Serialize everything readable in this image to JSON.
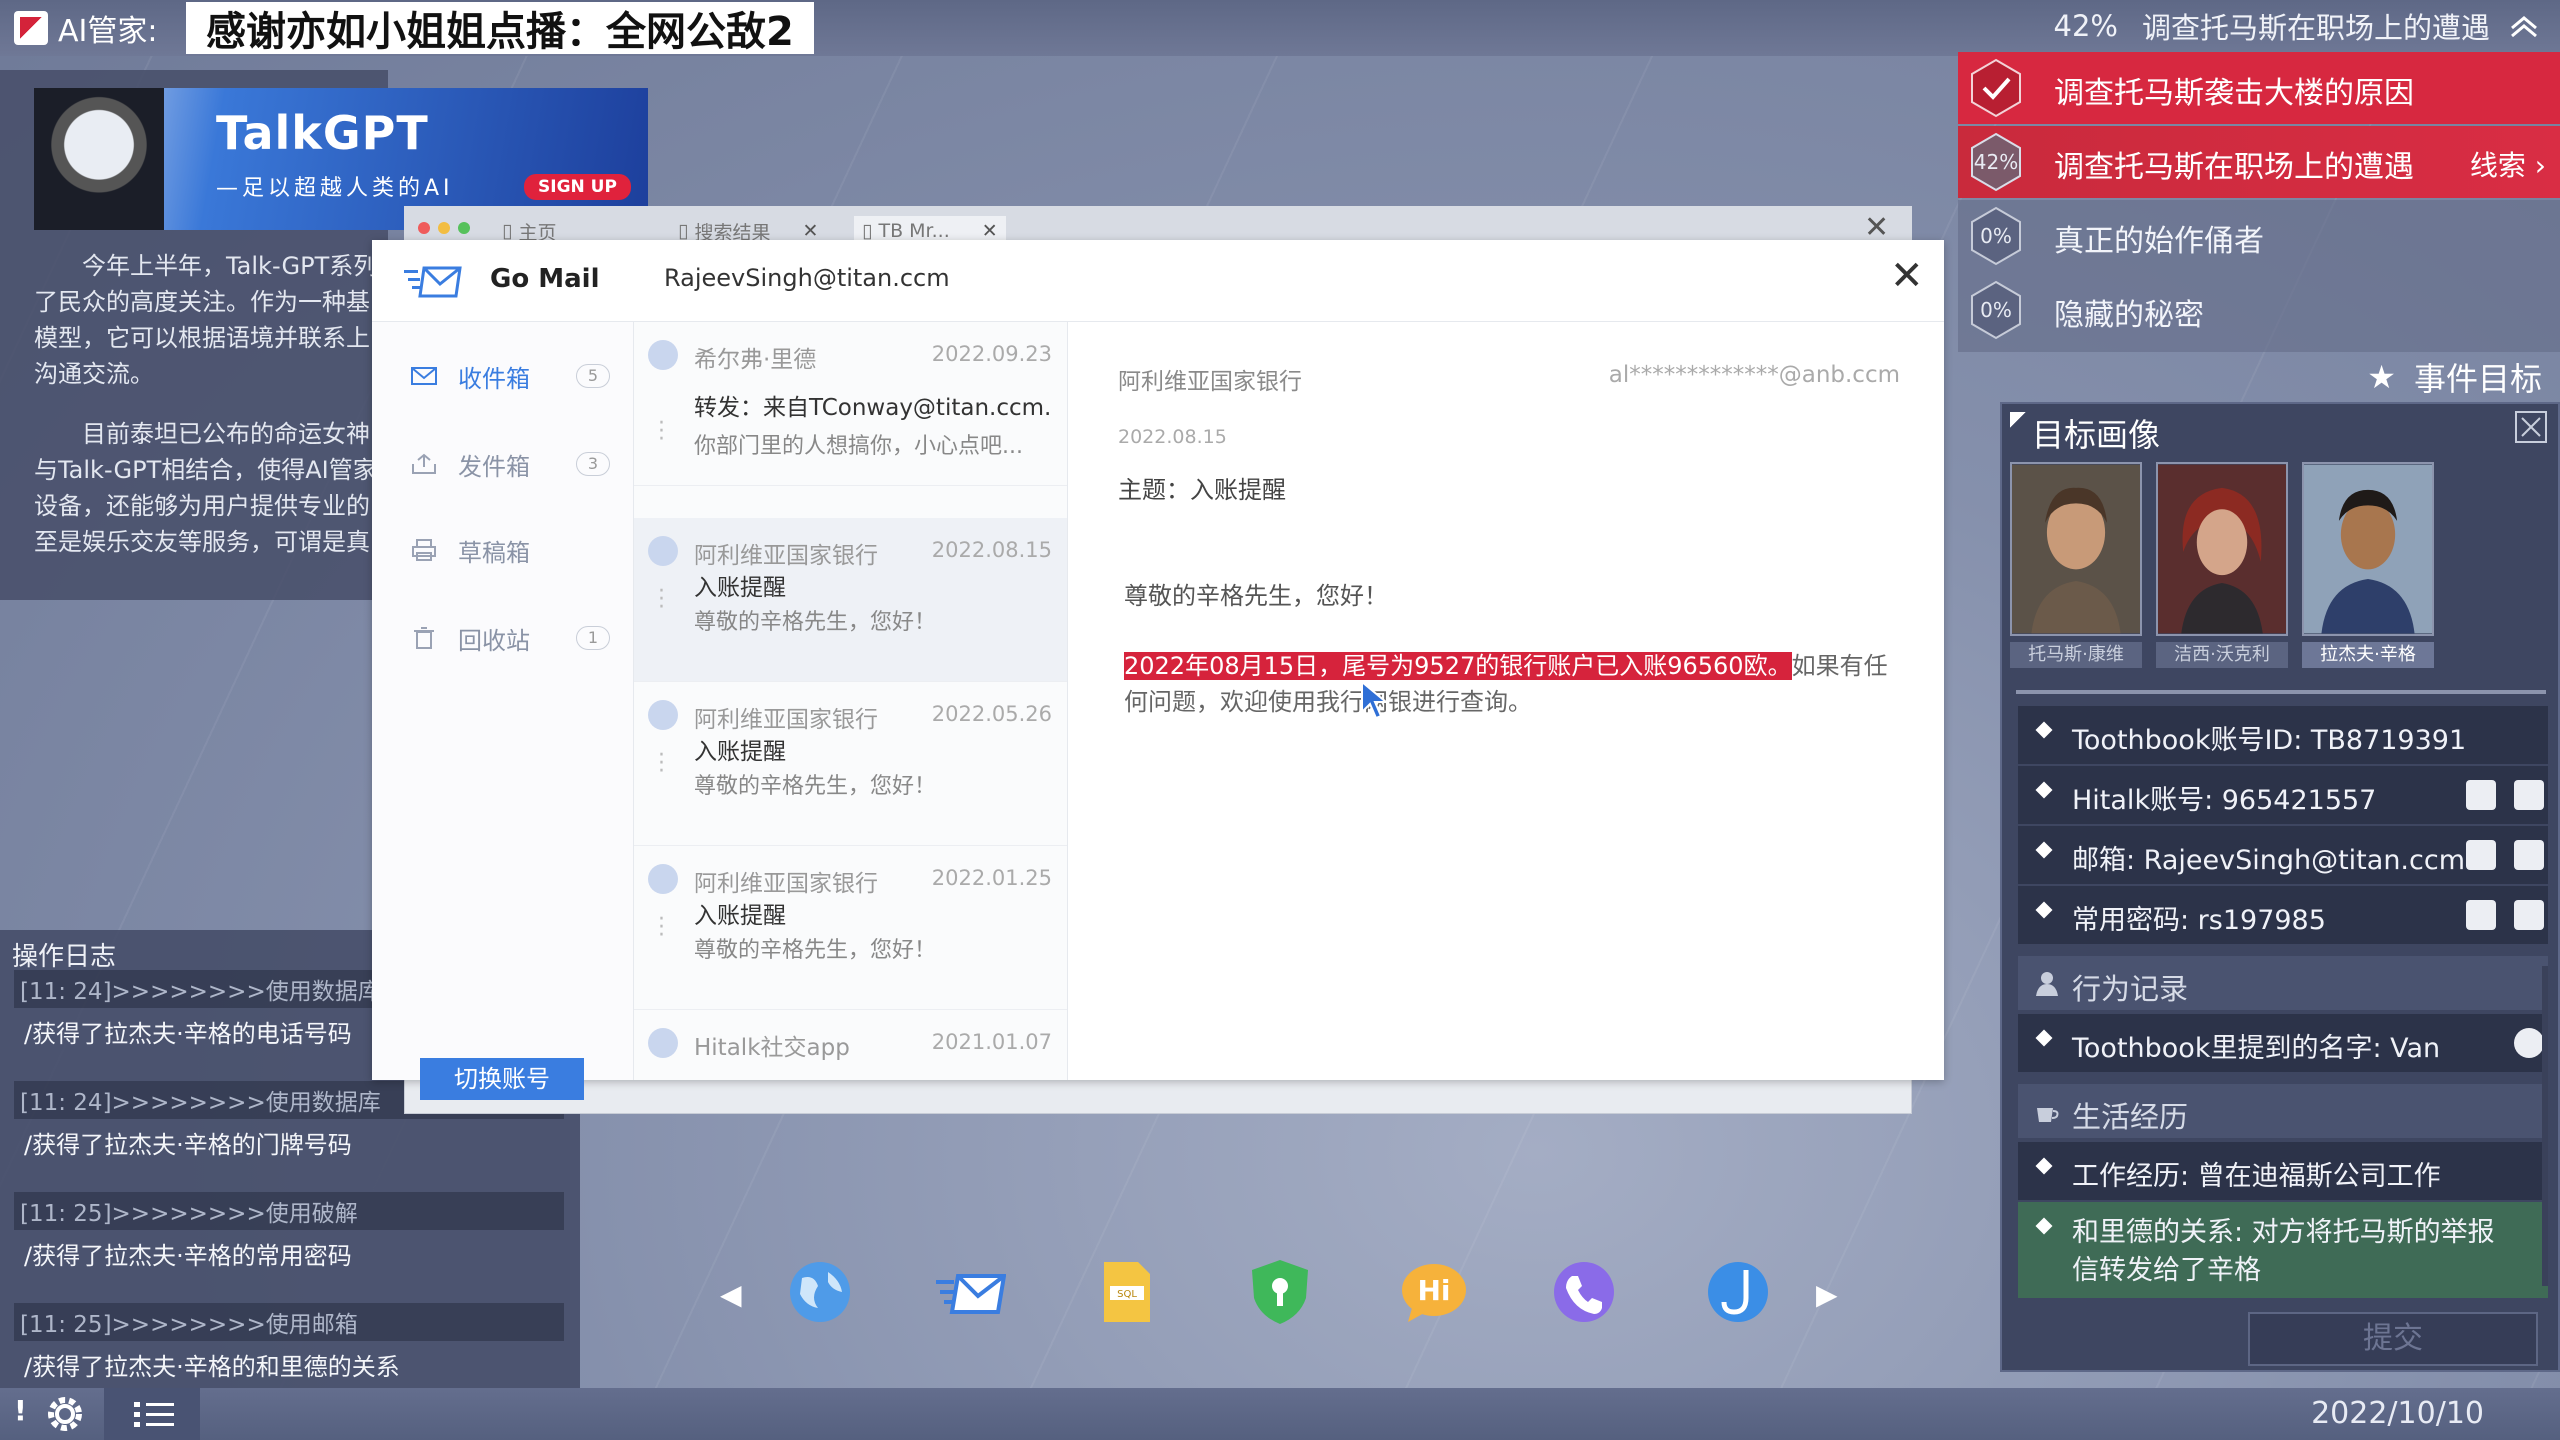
{
  "top": {
    "ai_label": "AI管家:",
    "banner": "感谢亦如小姐姐点播：全网公敌2",
    "current_quest_percent": "42%",
    "current_quest": "调查托马斯在职场上的遭遇"
  },
  "talkgpt": {
    "title": "TalkGPT",
    "subtitle": "—足以超越人类的AI",
    "sign_up": "SIGN UP"
  },
  "article": {
    "p1": "今年上半年，Talk-GPT系列了民众的高度关注。作为一种基模型，它可以根据语境并联系上沟通交流。",
    "p2": "目前泰坦已公布的命运女神与Talk-GPT相结合，使得AI管家设备，还能够为用户提供专业的至是娱乐交友等服务，可谓是真"
  },
  "log": {
    "title": "操作日志",
    "items": [
      {
        "head": "[11: 24]>>>>>>>>使用数据库",
        "body": "/获得了拉杰夫·辛格的电话号码"
      },
      {
        "head": "[11: 24]>>>>>>>>使用数据库",
        "body": "/获得了拉杰夫·辛格的门牌号码"
      },
      {
        "head": "[11: 25]>>>>>>>>使用破解",
        "body": "/获得了拉杰夫·辛格的常用密码"
      },
      {
        "head": "[11: 25]>>>>>>>>使用邮箱",
        "body": "/获得了拉杰夫·辛格的和里德的关系"
      }
    ]
  },
  "browser": {
    "tabs": [
      "主页",
      "搜索结果",
      "TB Mr..."
    ]
  },
  "mail": {
    "app_name": "Go Mail",
    "account": "RajeevSingh@titan.ccm",
    "folders": [
      {
        "label": "收件箱",
        "count": "5"
      },
      {
        "label": "发件箱",
        "count": "3"
      },
      {
        "label": "草稿箱",
        "count": ""
      },
      {
        "label": "回收站",
        "count": "1"
      }
    ],
    "switch_account": "切换账号",
    "messages": [
      {
        "sender": "希尔弗·里德",
        "date": "2022.09.23",
        "subject": "转发：来自TConway@titan.ccm...",
        "preview": "你部门里的人想搞你，小心点吧..."
      },
      {
        "sender": "阿利维亚国家银行",
        "date": "2022.08.15",
        "subject": "入账提醒",
        "preview": "尊敬的辛格先生，您好！"
      },
      {
        "sender": "阿利维亚国家银行",
        "date": "2022.05.26",
        "subject": "入账提醒",
        "preview": "尊敬的辛格先生，您好！"
      },
      {
        "sender": "阿利维亚国家银行",
        "date": "2022.01.25",
        "subject": "入账提醒",
        "preview": "尊敬的辛格先生，您好！"
      },
      {
        "sender": "Hitalk社交app",
        "date": "2021.01.07",
        "subject": "",
        "preview": ""
      }
    ],
    "detail": {
      "from": "阿利维亚国家银行",
      "from_addr": "al*************@anb.ccm",
      "date": "2022.08.15",
      "subject": "主题：入账提醒",
      "greeting": "尊敬的辛格先生，您好！",
      "highlight": "2022年08月15日，尾号为9527的银行账户已入账96560欧。",
      "rest": "如果有任何问题，欢迎使用我行网银进行查询。"
    }
  },
  "quests": [
    {
      "badge": "",
      "label": "调查托马斯袭击大楼的原因",
      "state": "done"
    },
    {
      "badge": "42%",
      "label": "调查托马斯在职场上的遭遇",
      "state": "active",
      "clue": "线索"
    },
    {
      "badge": "0%",
      "label": "真正的始作俑者",
      "state": "inactive"
    },
    {
      "badge": "0%",
      "label": "隐藏的秘密",
      "state": "inactive"
    }
  ],
  "event_target": "事件目标",
  "target": {
    "title": "目标画像",
    "people": [
      "托马斯·康维",
      "洁西·沃克利",
      "拉杰夫·辛格"
    ],
    "info": [
      "Toothbook账号ID: TB8719391",
      "Hitalk账号: 965421557",
      "邮箱: RajeevSingh@titan.ccm",
      "常用密码: rs197985"
    ],
    "behavior_title": "行为记录",
    "behavior": [
      "Toothbook里提到的名字: Van"
    ],
    "life_title": "生活经历",
    "life": [
      "工作经历: 曾在迪福斯公司工作",
      "和里德的关系: 对方将托马斯的举报信转发给了辛格"
    ],
    "submit": "提交"
  },
  "status": {
    "date": "2022/10/10",
    "alert": "!"
  },
  "colors": {
    "accent_red": "#d72840",
    "mail_blue": "#3a7de0",
    "life_green": "#3f6b56"
  }
}
